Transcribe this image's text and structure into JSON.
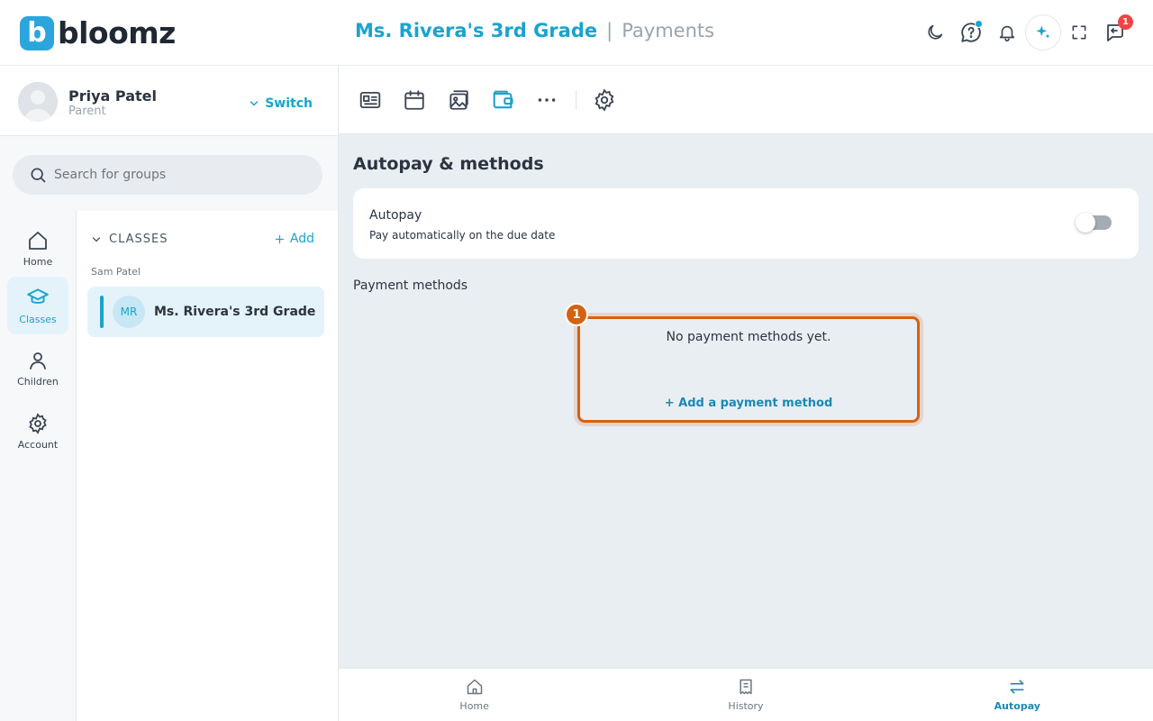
{
  "app": {
    "logo_letter": "b",
    "name": "bloomz"
  },
  "header": {
    "group_title": "Ms. Rivera's 3rd Grade",
    "separator": "|",
    "section": "Payments",
    "messages_badge": "1"
  },
  "user": {
    "name": "Priya Patel",
    "role": "Parent",
    "switch_label": "Switch"
  },
  "search": {
    "placeholder": "Search for groups"
  },
  "rail": [
    {
      "label": "Home",
      "icon": "home-icon"
    },
    {
      "label": "Classes",
      "icon": "graduation-cap-icon",
      "active": true
    },
    {
      "label": "Children",
      "icon": "person-icon"
    },
    {
      "label": "Account",
      "icon": "gear-icon"
    }
  ],
  "groups": {
    "heading": "CLASSES",
    "add_label": "Add",
    "child_label": "Sam Patel",
    "items": [
      {
        "initials": "MR",
        "name": "Ms. Rivera's 3rd Grade"
      }
    ]
  },
  "main": {
    "section_title": "Autopay & methods",
    "autopay": {
      "title": "Autopay",
      "subtitle": "Pay automatically on the due date",
      "enabled": false
    },
    "payment_methods_label": "Payment methods",
    "empty_text": "No payment methods yet.",
    "add_method_label": "+ Add a payment method",
    "marker_number": "1"
  },
  "bottom_nav": [
    {
      "label": "Home",
      "icon": "home-icon"
    },
    {
      "label": "History",
      "icon": "receipt-icon"
    },
    {
      "label": "Autopay",
      "icon": "swap-arrows-icon",
      "active": true
    }
  ],
  "colors": {
    "accent": "#1aa3cf",
    "highlight": "#d5620f",
    "badge": "#ef4444"
  }
}
